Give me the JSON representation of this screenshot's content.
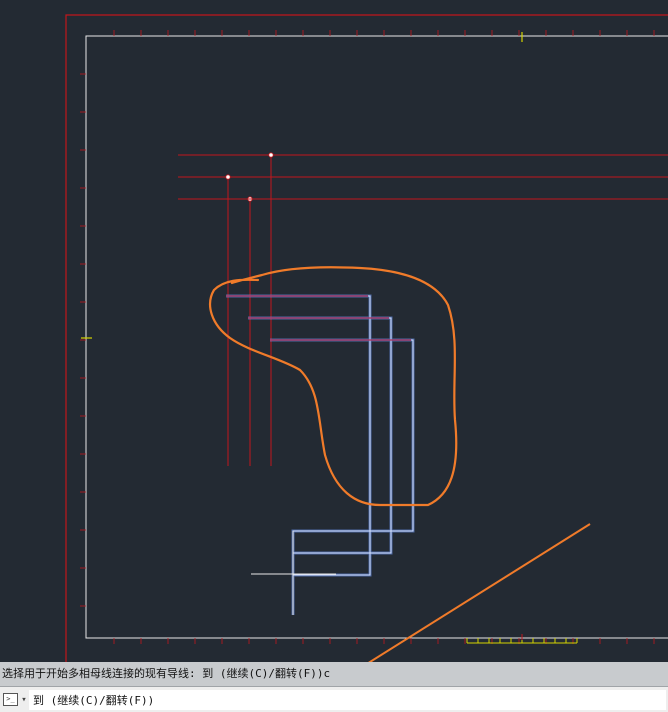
{
  "command_line": {
    "history_text": "选择用于开始多相母线连接的现有导线: 到 (继续(C)/翻转(F))c",
    "current_prompt": "到 (继续(C)/翻转(F))",
    "icon": "command-prompt-icon"
  },
  "colors": {
    "background": "#232a33",
    "title_border": "#c0161c",
    "drawing_border": "#e8e8e8",
    "wire": "#c0161c",
    "bus_line": "#6f9cff",
    "annotation": "#f07b2a",
    "crosshair": "#e8e8e8",
    "grip": "#d4d400"
  }
}
